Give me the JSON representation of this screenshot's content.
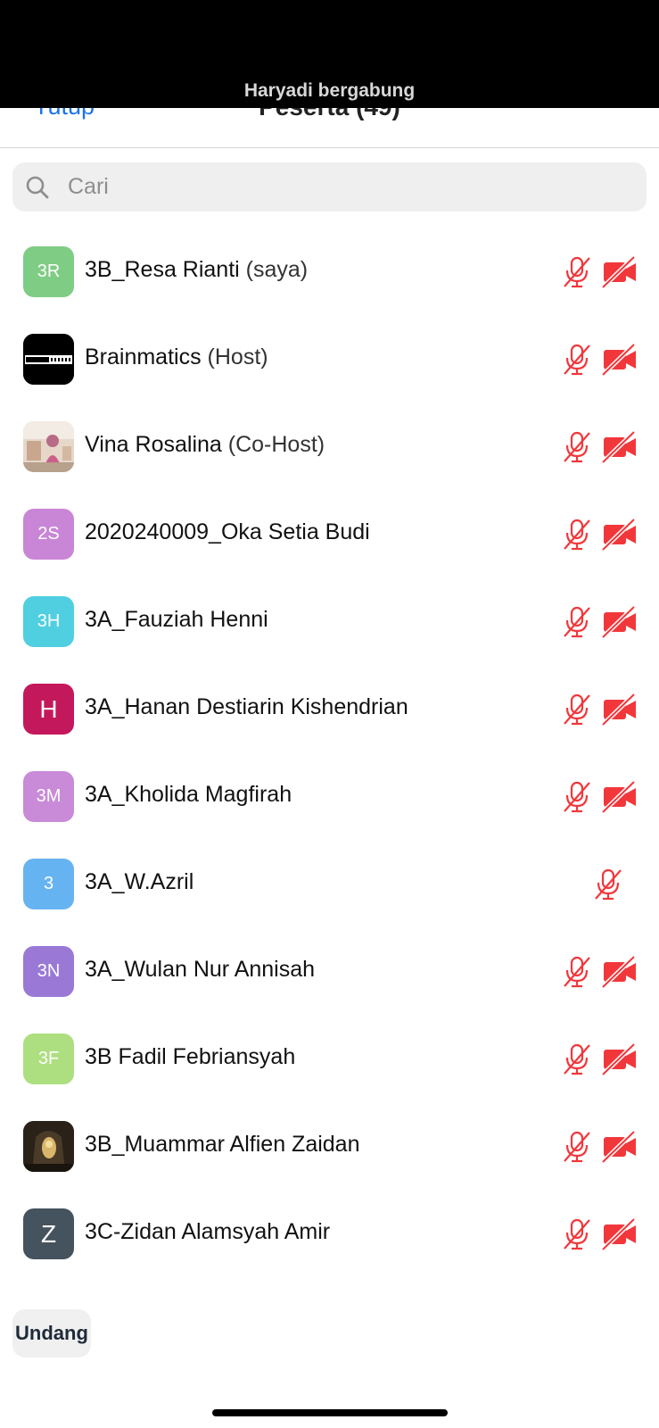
{
  "toast": {
    "text": "Haryadi bergabung"
  },
  "header": {
    "close_label": "Tutup",
    "title": "Peserta (49)"
  },
  "search": {
    "placeholder": "Cari"
  },
  "participants": [
    {
      "name": "3B_Resa Rianti",
      "role": "(saya)",
      "initials": "3R",
      "avatar_color": "#7fcc85",
      "mic": "muted",
      "video": "off"
    },
    {
      "name": "Brainmatics",
      "role": "(Host)",
      "logo_text": "BRAINMATICS",
      "avatar_color": "#000000",
      "mic": "muted",
      "video": "off"
    },
    {
      "name": "Vina Rosalina",
      "role": "(Co-Host)",
      "avatar_color": "#d9c2b2",
      "mic": "muted",
      "video": "off"
    },
    {
      "name": "2020240009_Oka Setia Budi",
      "role": "",
      "initials": "2S",
      "avatar_color": "#c985d6",
      "mic": "muted",
      "video": "off"
    },
    {
      "name": "3A_Fauziah Henni",
      "role": "",
      "initials": "3H",
      "avatar_color": "#4fcfe0",
      "mic": "muted",
      "video": "off"
    },
    {
      "name": "3A_Hanan Destiarin Kishendrian",
      "role": "",
      "initials": "H",
      "avatar_color": "#c4185c",
      "mic": "muted",
      "video": "off"
    },
    {
      "name": "3A_Kholida Magfirah",
      "role": "",
      "initials": "3M",
      "avatar_color": "#c98ad8",
      "mic": "muted",
      "video": "off"
    },
    {
      "name": "3A_W.Azril",
      "role": "",
      "initials": "3",
      "avatar_color": "#66b3f2",
      "mic": "muted",
      "video": "none"
    },
    {
      "name": "3A_Wulan Nur Annisah",
      "role": "",
      "initials": "3N",
      "avatar_color": "#9a79d6",
      "mic": "muted",
      "video": "off"
    },
    {
      "name": "3B Fadil Febriansyah",
      "role": "",
      "initials": "3F",
      "avatar_color": "#addf80",
      "mic": "muted",
      "video": "off"
    },
    {
      "name": "3B_Muammar Alfien Zaidan",
      "role": "",
      "avatar_color": "#3b2f22",
      "mic": "muted",
      "video": "off"
    },
    {
      "name": "3C-Zidan Alamsyah Amir",
      "role": "",
      "initials": "Z",
      "avatar_color": "#45535e",
      "mic": "muted",
      "video": "off"
    }
  ],
  "footer": {
    "invite_label": "Undang"
  },
  "colors": {
    "accent": "#1a73e8",
    "muted_red": "#f2373b"
  }
}
